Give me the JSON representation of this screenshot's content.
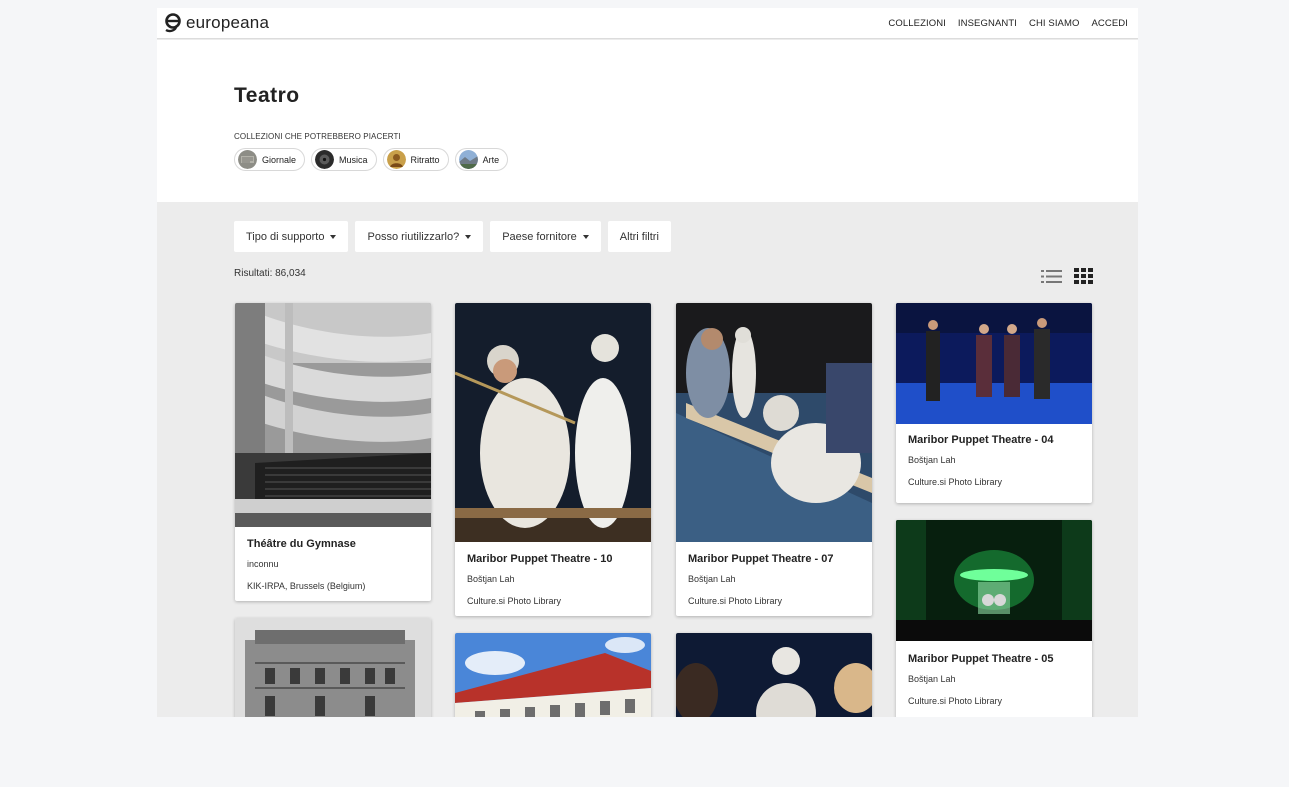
{
  "header": {
    "logo_text": "europeana",
    "nav": [
      "COLLEZIONI",
      "INSEGNANTI",
      "CHI SIAMO",
      "ACCEDI"
    ]
  },
  "hero": {
    "title": "Teatro",
    "suggest_label": "COLLEZIONI CHE POTREBBERO PIACERTI",
    "chips": [
      "Giornale",
      "Musica",
      "Ritratto",
      "Arte"
    ]
  },
  "filters": {
    "items": [
      "Tipo di supporto",
      "Posso riutilizzarlo?",
      "Paese fornitore",
      "Altri filtri"
    ],
    "results": "Risultati: 86,034"
  },
  "view_toggle": {
    "list_icon": "list-icon",
    "grid_icon": "grid-icon",
    "active": "grid"
  },
  "cards": [
    {
      "title": "Théâtre du Gymnase",
      "author": "inconnu",
      "provider": "KIK-IRPA, Brussels (Belgium)"
    },
    {
      "title": "Maribor Puppet Theatre - 10",
      "author": "Boštjan Lah",
      "provider": "Culture.si Photo Library"
    },
    {
      "title": "Maribor Puppet Theatre - 07",
      "author": "Boštjan Lah",
      "provider": "Culture.si Photo Library"
    },
    {
      "title": "Maribor Puppet Theatre - 04",
      "author": "Boštjan Lah",
      "provider": "Culture.si Photo Library"
    },
    {
      "title": "Maribor Puppet Theatre - 05",
      "author": "Boštjan Lah",
      "provider": "Culture.si Photo Library"
    }
  ],
  "colors": {
    "page_bg": "#f5f6f8",
    "content_bg": "#ececec",
    "card_bg": "#ffffff",
    "text": "#222222"
  }
}
